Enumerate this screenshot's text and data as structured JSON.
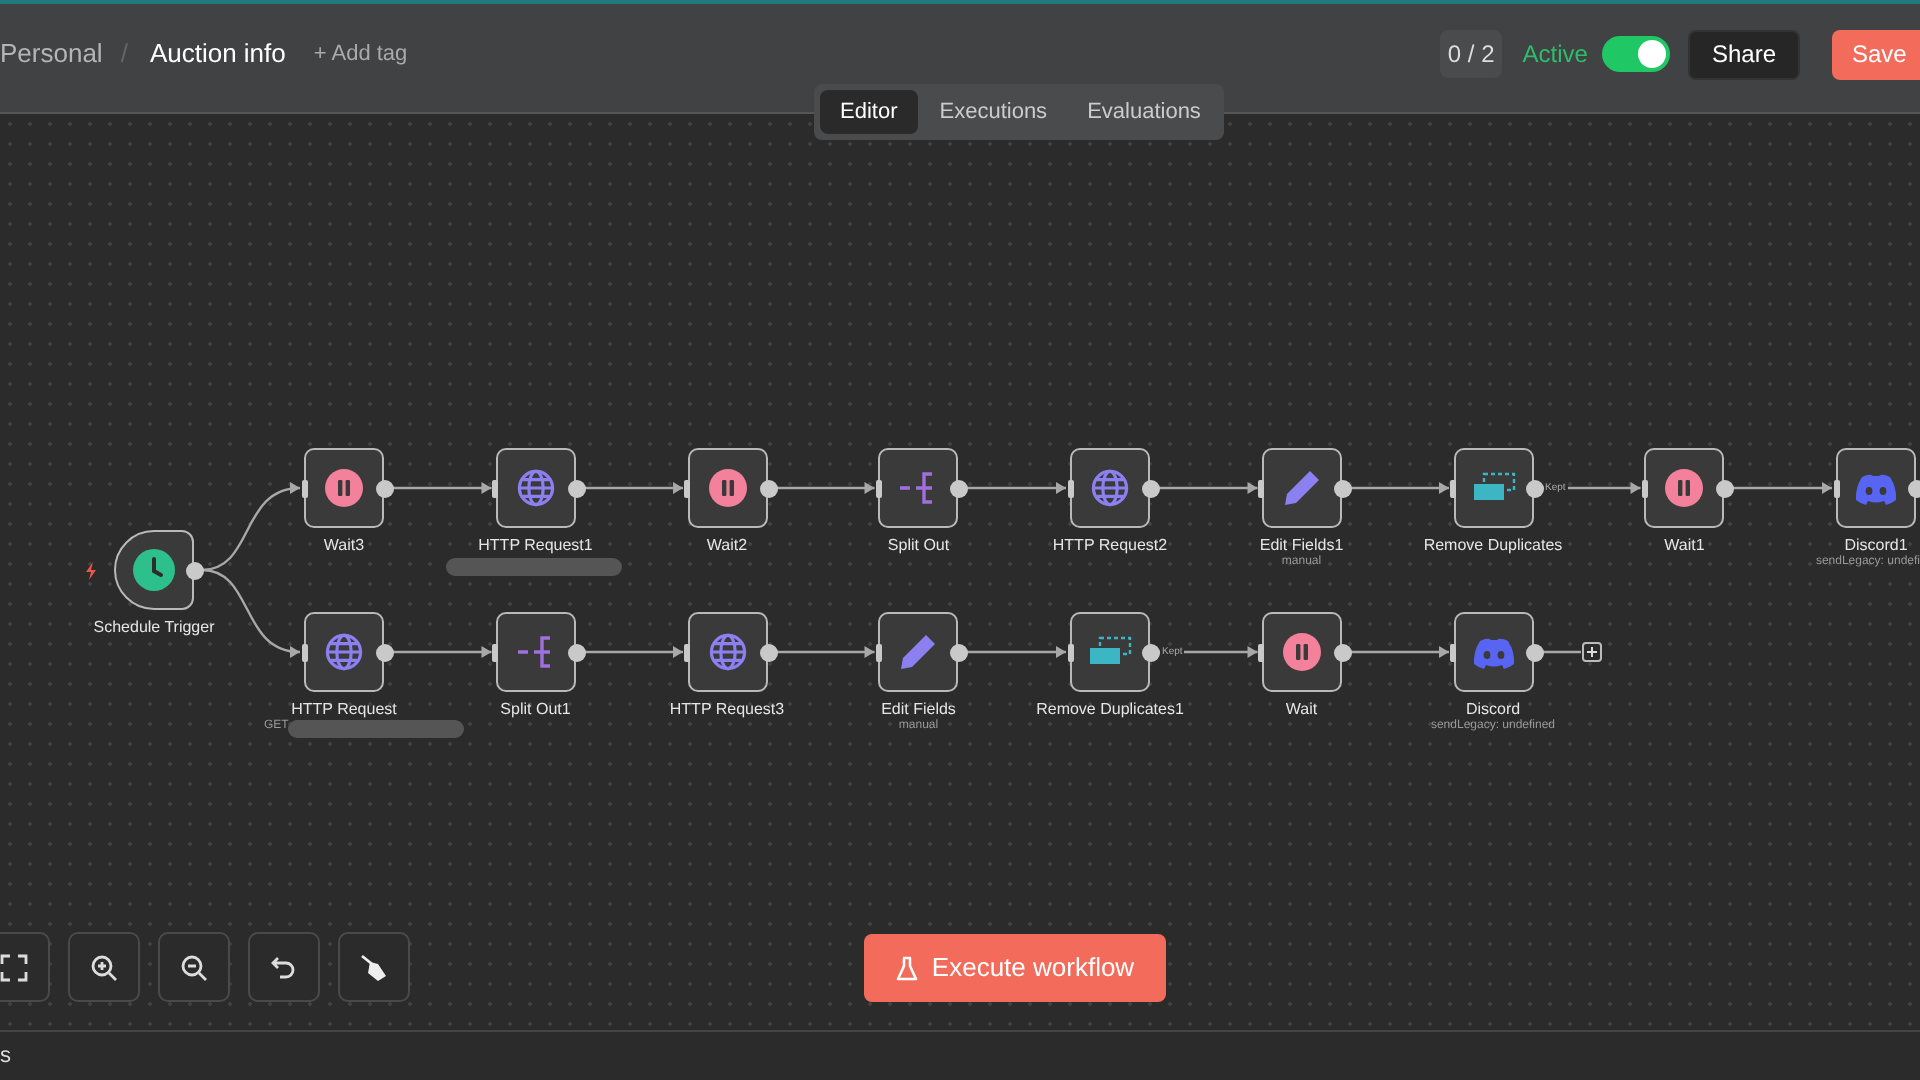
{
  "header": {
    "breadcrumb": "Personal",
    "separator": "/",
    "workflow_name": "Auction info",
    "add_tag": "+ Add tag",
    "counter": "0 / 2",
    "active_label": "Active",
    "active": true,
    "share": "Share",
    "save": "Save"
  },
  "tabs": [
    {
      "label": "Editor",
      "selected": true
    },
    {
      "label": "Executions",
      "selected": false
    },
    {
      "label": "Evaluations",
      "selected": false
    }
  ],
  "trigger": {
    "kind": "schedule",
    "label": "Schedule Trigger"
  },
  "rows": [
    {
      "add_button": false,
      "nodes": [
        {
          "kind": "wait",
          "label": "Wait3",
          "scribbled": false
        },
        {
          "kind": "http",
          "label": "HTTP Request1",
          "scribbled": true
        },
        {
          "kind": "wait",
          "label": "Wait2",
          "scribbled": false
        },
        {
          "kind": "split",
          "label": "Split Out",
          "scribbled": false
        },
        {
          "kind": "http",
          "label": "HTTP Request2",
          "scribbled": false
        },
        {
          "kind": "edit",
          "label": "Edit Fields1",
          "subtitle": "manual",
          "scribbled": false
        },
        {
          "kind": "dedupe",
          "label": "Remove Duplicates",
          "output_label": "Kept",
          "scribbled": false
        },
        {
          "kind": "wait",
          "label": "Wait1",
          "scribbled": false
        },
        {
          "kind": "discord",
          "label": "Discord1",
          "subtitle": "sendLegacy: undefi",
          "scribbled": false
        }
      ]
    },
    {
      "add_button": true,
      "nodes": [
        {
          "kind": "http",
          "label": "HTTP Request",
          "subtitle": "GET",
          "scribbled": true
        },
        {
          "kind": "split",
          "label": "Split Out1",
          "scribbled": false
        },
        {
          "kind": "http",
          "label": "HTTP Request3",
          "scribbled": false
        },
        {
          "kind": "edit",
          "label": "Edit Fields",
          "subtitle": "manual",
          "scribbled": false
        },
        {
          "kind": "dedupe",
          "label": "Remove Duplicates1",
          "output_label": "Kept",
          "scribbled": false
        },
        {
          "kind": "wait",
          "label": "Wait",
          "scribbled": false
        },
        {
          "kind": "discord",
          "label": "Discord",
          "subtitle": "sendLegacy: undefined",
          "scribbled": false
        }
      ]
    }
  ],
  "toolbar": [
    {
      "kind": "fit"
    },
    {
      "kind": "zoom_in"
    },
    {
      "kind": "zoom_out"
    },
    {
      "kind": "undo"
    },
    {
      "kind": "clean"
    }
  ],
  "execute_button": "Execute workflow",
  "bottom_bar": {
    "text": "s"
  }
}
